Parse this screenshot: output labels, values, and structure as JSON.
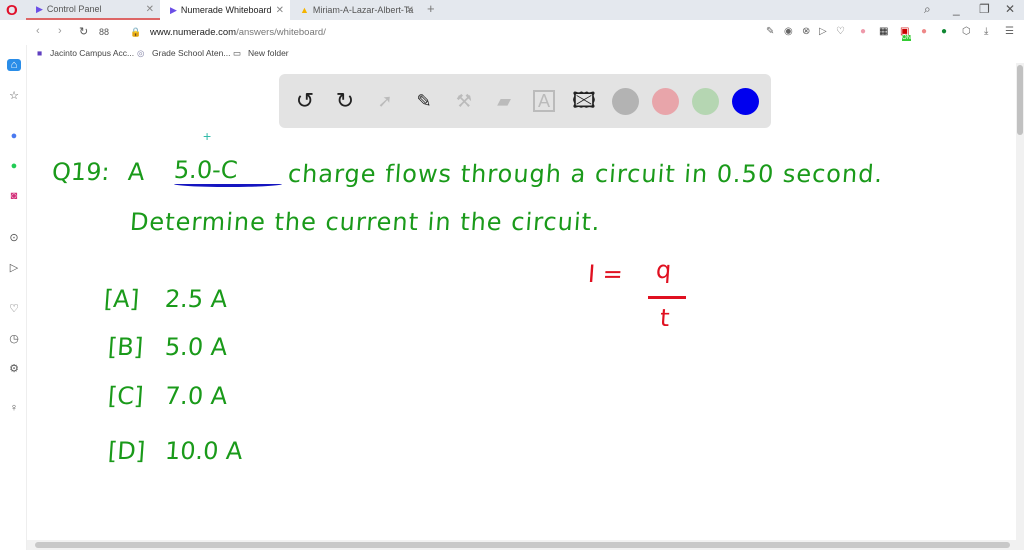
{
  "browser": {
    "tabs": [
      {
        "label": "Control Panel"
      },
      {
        "label": "Numerade Whiteboard"
      },
      {
        "label": "Miriam-A-Lazar-Albert-Ta"
      }
    ],
    "url_domain": "www.numerade.com",
    "url_path": "/answers/whiteboard/",
    "bookmarks": [
      "Jacinto Campus Acc...",
      "Grade School Aten...",
      "New folder"
    ],
    "badge": "ON"
  },
  "toolbar": {
    "tools": [
      "undo",
      "redo",
      "select",
      "pen",
      "tools",
      "eraser",
      "text",
      "image"
    ],
    "colors": [
      "#b3b3b3",
      "#e8a5aa",
      "#b5d6b2",
      "#0000ee"
    ]
  },
  "board": {
    "question_label": "Q19:",
    "line1": "A",
    "highlight": "5.0-C",
    "line1_rest": "charge flows through a circuit in 0.50 second.",
    "line2": "Determine the current in the circuit.",
    "choices": [
      {
        "key": "[A]",
        "value": "2.5 A"
      },
      {
        "key": "[B]",
        "value": "5.0 A"
      },
      {
        "key": "[C]",
        "value": "7.0 A"
      },
      {
        "key": "[D]",
        "value": "10.0 A"
      }
    ],
    "formula_lhs": "I =",
    "formula_num": "q",
    "formula_den": "t"
  }
}
